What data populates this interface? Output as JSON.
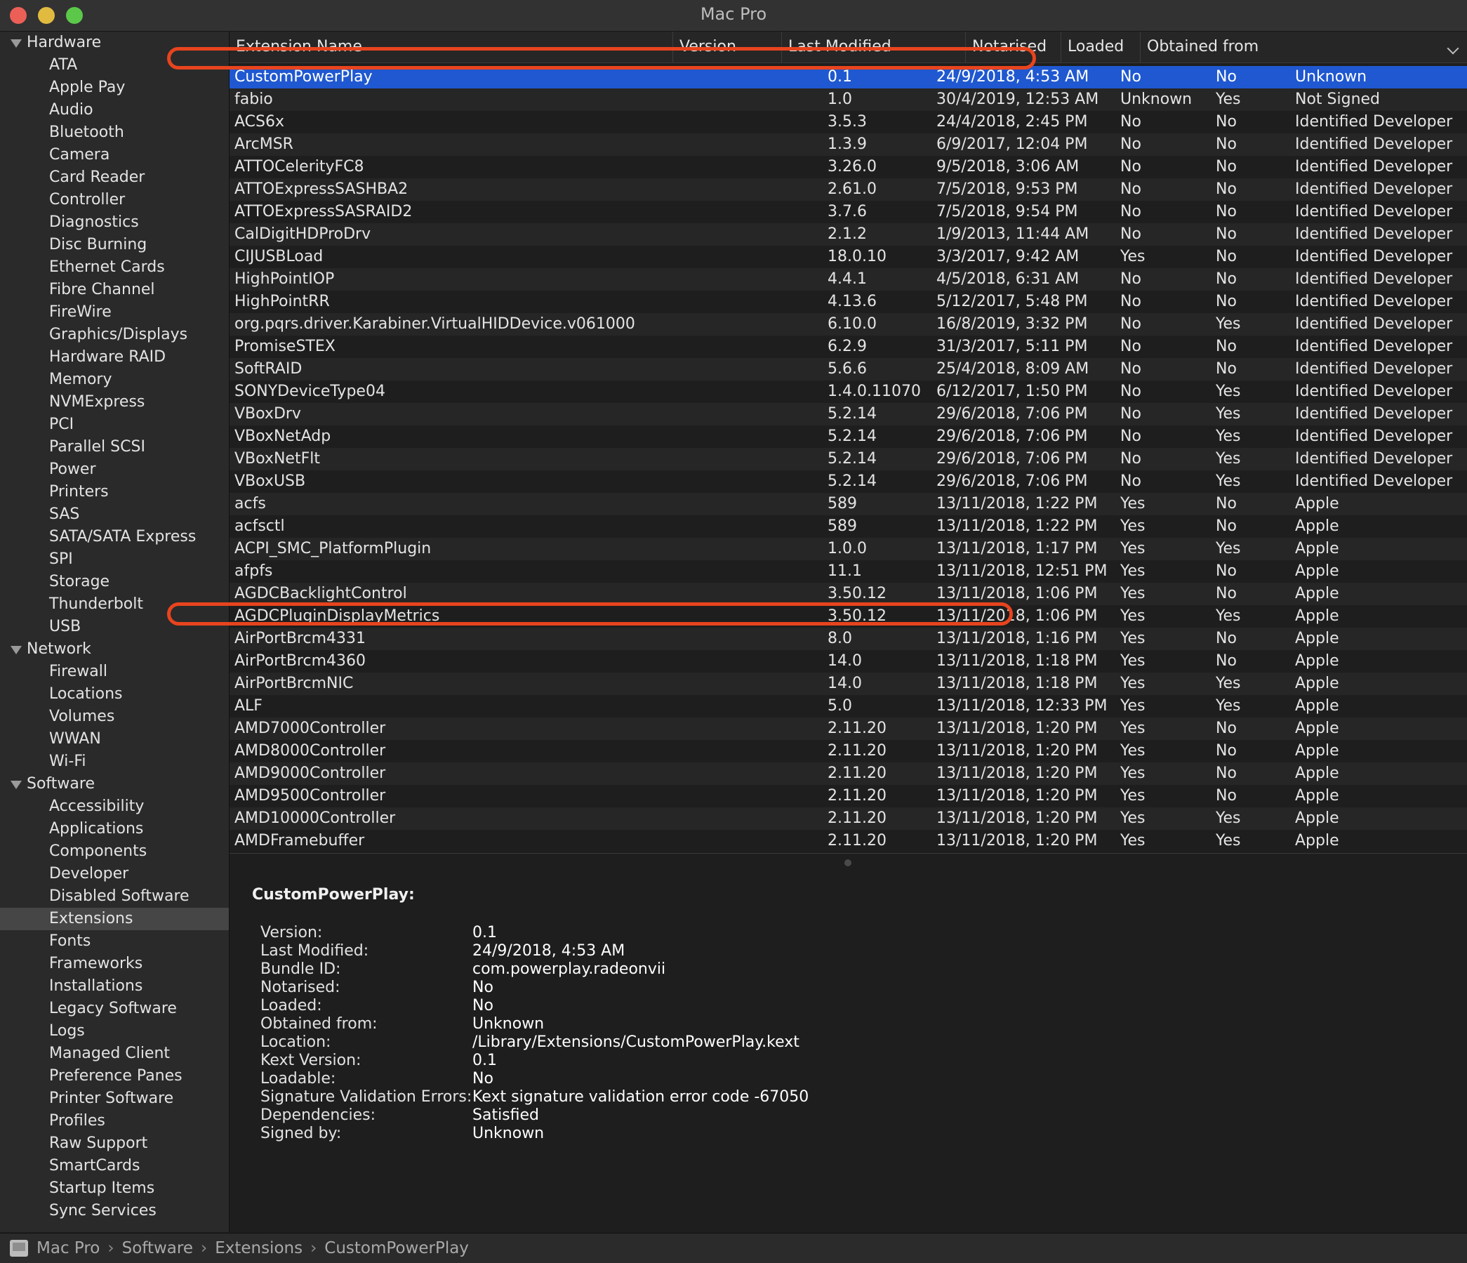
{
  "window": {
    "title": "Mac Pro"
  },
  "sidebar": [
    {
      "label": "Hardware",
      "type": "section"
    },
    {
      "label": "ATA",
      "type": "item"
    },
    {
      "label": "Apple Pay",
      "type": "item"
    },
    {
      "label": "Audio",
      "type": "item"
    },
    {
      "label": "Bluetooth",
      "type": "item"
    },
    {
      "label": "Camera",
      "type": "item"
    },
    {
      "label": "Card Reader",
      "type": "item"
    },
    {
      "label": "Controller",
      "type": "item"
    },
    {
      "label": "Diagnostics",
      "type": "item"
    },
    {
      "label": "Disc Burning",
      "type": "item"
    },
    {
      "label": "Ethernet Cards",
      "type": "item"
    },
    {
      "label": "Fibre Channel",
      "type": "item"
    },
    {
      "label": "FireWire",
      "type": "item"
    },
    {
      "label": "Graphics/Displays",
      "type": "item"
    },
    {
      "label": "Hardware RAID",
      "type": "item"
    },
    {
      "label": "Memory",
      "type": "item"
    },
    {
      "label": "NVMExpress",
      "type": "item"
    },
    {
      "label": "PCI",
      "type": "item"
    },
    {
      "label": "Parallel SCSI",
      "type": "item"
    },
    {
      "label": "Power",
      "type": "item"
    },
    {
      "label": "Printers",
      "type": "item"
    },
    {
      "label": "SAS",
      "type": "item"
    },
    {
      "label": "SATA/SATA Express",
      "type": "item"
    },
    {
      "label": "SPI",
      "type": "item"
    },
    {
      "label": "Storage",
      "type": "item"
    },
    {
      "label": "Thunderbolt",
      "type": "item"
    },
    {
      "label": "USB",
      "type": "item"
    },
    {
      "label": "Network",
      "type": "section"
    },
    {
      "label": "Firewall",
      "type": "item"
    },
    {
      "label": "Locations",
      "type": "item"
    },
    {
      "label": "Volumes",
      "type": "item"
    },
    {
      "label": "WWAN",
      "type": "item"
    },
    {
      "label": "Wi-Fi",
      "type": "item"
    },
    {
      "label": "Software",
      "type": "section"
    },
    {
      "label": "Accessibility",
      "type": "item"
    },
    {
      "label": "Applications",
      "type": "item"
    },
    {
      "label": "Components",
      "type": "item"
    },
    {
      "label": "Developer",
      "type": "item"
    },
    {
      "label": "Disabled Software",
      "type": "item"
    },
    {
      "label": "Extensions",
      "type": "item",
      "selected": true
    },
    {
      "label": "Fonts",
      "type": "item"
    },
    {
      "label": "Frameworks",
      "type": "item"
    },
    {
      "label": "Installations",
      "type": "item"
    },
    {
      "label": "Legacy Software",
      "type": "item"
    },
    {
      "label": "Logs",
      "type": "item"
    },
    {
      "label": "Managed Client",
      "type": "item"
    },
    {
      "label": "Preference Panes",
      "type": "item"
    },
    {
      "label": "Printer Software",
      "type": "item"
    },
    {
      "label": "Profiles",
      "type": "item"
    },
    {
      "label": "Raw Support",
      "type": "item"
    },
    {
      "label": "SmartCards",
      "type": "item"
    },
    {
      "label": "Startup Items",
      "type": "item"
    },
    {
      "label": "Sync Services",
      "type": "item"
    }
  ],
  "table": {
    "columns": {
      "name": "Extension Name",
      "version": "Version",
      "modified": "Last Modified",
      "notarised": "Notarised",
      "loaded": "Loaded",
      "obtained": "Obtained from"
    },
    "rows": [
      [
        "CustomPowerPlay",
        "0.1",
        "24/9/2018, 4:53 AM",
        "No",
        "No",
        "Unknown"
      ],
      [
        "fabio",
        "1.0",
        "30/4/2019, 12:53 AM",
        "Unknown",
        "Yes",
        "Not Signed"
      ],
      [
        "ACS6x",
        "3.5.3",
        "24/4/2018, 2:45 PM",
        "No",
        "No",
        "Identified Developer"
      ],
      [
        "ArcMSR",
        "1.3.9",
        "6/9/2017, 12:04 PM",
        "No",
        "No",
        "Identified Developer"
      ],
      [
        "ATTOCelerityFC8",
        "3.26.0",
        "9/5/2018, 3:06 AM",
        "No",
        "No",
        "Identified Developer"
      ],
      [
        "ATTOExpressSASHBA2",
        "2.61.0",
        "7/5/2018, 9:53 PM",
        "No",
        "No",
        "Identified Developer"
      ],
      [
        "ATTOExpressSASRAID2",
        "3.7.6",
        "7/5/2018, 9:54 PM",
        "No",
        "No",
        "Identified Developer"
      ],
      [
        "CalDigitHDProDrv",
        "2.1.2",
        "1/9/2013, 11:44 AM",
        "No",
        "No",
        "Identified Developer"
      ],
      [
        "CIJUSBLoad",
        "18.0.10",
        "3/3/2017, 9:42 AM",
        "Yes",
        "No",
        "Identified Developer"
      ],
      [
        "HighPointIOP",
        "4.4.1",
        "4/5/2018, 6:31 AM",
        "No",
        "No",
        "Identified Developer"
      ],
      [
        "HighPointRR",
        "4.13.6",
        "5/12/2017, 5:48 PM",
        "No",
        "No",
        "Identified Developer"
      ],
      [
        "org.pqrs.driver.Karabiner.VirtualHIDDevice.v061000",
        "6.10.0",
        "16/8/2019, 3:32 PM",
        "No",
        "Yes",
        "Identified Developer"
      ],
      [
        "PromiseSTEX",
        "6.2.9",
        "31/3/2017, 5:11 PM",
        "No",
        "No",
        "Identified Developer"
      ],
      [
        "SoftRAID",
        "5.6.6",
        "25/4/2018, 8:09 AM",
        "No",
        "No",
        "Identified Developer"
      ],
      [
        "SONYDeviceType04",
        "1.4.0.11070",
        "6/12/2017, 1:50 PM",
        "No",
        "Yes",
        "Identified Developer"
      ],
      [
        "VBoxDrv",
        "5.2.14",
        "29/6/2018, 7:06 PM",
        "No",
        "Yes",
        "Identified Developer"
      ],
      [
        "VBoxNetAdp",
        "5.2.14",
        "29/6/2018, 7:06 PM",
        "No",
        "Yes",
        "Identified Developer"
      ],
      [
        "VBoxNetFlt",
        "5.2.14",
        "29/6/2018, 7:06 PM",
        "No",
        "Yes",
        "Identified Developer"
      ],
      [
        "VBoxUSB",
        "5.2.14",
        "29/6/2018, 7:06 PM",
        "No",
        "Yes",
        "Identified Developer"
      ],
      [
        "acfs",
        "589",
        "13/11/2018, 1:22 PM",
        "Yes",
        "No",
        "Apple"
      ],
      [
        "acfsctl",
        "589",
        "13/11/2018, 1:22 PM",
        "Yes",
        "No",
        "Apple"
      ],
      [
        "ACPI_SMC_PlatformPlugin",
        "1.0.0",
        "13/11/2018, 1:17 PM",
        "Yes",
        "Yes",
        "Apple"
      ],
      [
        "afpfs",
        "11.1",
        "13/11/2018, 12:51 PM",
        "Yes",
        "No",
        "Apple"
      ],
      [
        "AGDCBacklightControl",
        "3.50.12",
        "13/11/2018, 1:06 PM",
        "Yes",
        "No",
        "Apple"
      ],
      [
        "AGDCPluginDisplayMetrics",
        "3.50.12",
        "13/11/2018, 1:06 PM",
        "Yes",
        "Yes",
        "Apple"
      ],
      [
        "AirPortBrcm4331",
        "8.0",
        "13/11/2018, 1:16 PM",
        "Yes",
        "No",
        "Apple"
      ],
      [
        "AirPortBrcm4360",
        "14.0",
        "13/11/2018, 1:18 PM",
        "Yes",
        "No",
        "Apple"
      ],
      [
        "AirPortBrcmNIC",
        "14.0",
        "13/11/2018, 1:18 PM",
        "Yes",
        "Yes",
        "Apple"
      ],
      [
        "ALF",
        "5.0",
        "13/11/2018, 12:33 PM",
        "Yes",
        "Yes",
        "Apple"
      ],
      [
        "AMD7000Controller",
        "2.11.20",
        "13/11/2018, 1:20 PM",
        "Yes",
        "No",
        "Apple"
      ],
      [
        "AMD8000Controller",
        "2.11.20",
        "13/11/2018, 1:20 PM",
        "Yes",
        "No",
        "Apple"
      ],
      [
        "AMD9000Controller",
        "2.11.20",
        "13/11/2018, 1:20 PM",
        "Yes",
        "No",
        "Apple"
      ],
      [
        "AMD9500Controller",
        "2.11.20",
        "13/11/2018, 1:20 PM",
        "Yes",
        "No",
        "Apple"
      ],
      [
        "AMD10000Controller",
        "2.11.20",
        "13/11/2018, 1:20 PM",
        "Yes",
        "Yes",
        "Apple"
      ],
      [
        "AMDFramebuffer",
        "2.11.20",
        "13/11/2018, 1:20 PM",
        "Yes",
        "Yes",
        "Apple"
      ]
    ]
  },
  "detail": {
    "title": "CustomPowerPlay:",
    "fields": [
      {
        "key": "Version:",
        "value": "0.1"
      },
      {
        "key": "Last Modified:",
        "value": "24/9/2018, 4:53 AM"
      },
      {
        "key": "Bundle ID:",
        "value": "com.powerplay.radeonvii"
      },
      {
        "key": "Notarised:",
        "value": "No"
      },
      {
        "key": "Loaded:",
        "value": "No"
      },
      {
        "key": "Obtained from:",
        "value": "Unknown"
      },
      {
        "key": "Location:",
        "value": "/Library/Extensions/CustomPowerPlay.kext"
      },
      {
        "key": "Kext Version:",
        "value": "0.1"
      },
      {
        "key": "Loadable:",
        "value": "No"
      },
      {
        "key": "Signature Validation Errors:",
        "value": "Kext signature validation error code -67050"
      },
      {
        "key": "Dependencies:",
        "value": "Satisfied"
      },
      {
        "key": "Signed by:",
        "value": "Unknown"
      }
    ]
  },
  "pathbar": [
    "Mac Pro",
    "Software",
    "Extensions",
    "CustomPowerPlay"
  ],
  "colors": {
    "selection": "#1f58d0",
    "annotation": "#e8441e",
    "close": "#ec5f57",
    "minimize": "#e0bb3f",
    "zoom": "#5cc84a"
  },
  "icons": {
    "disclosure": "disclosure-triangle-icon",
    "sort": "chevron-down-icon",
    "path_root": "computer-icon"
  }
}
